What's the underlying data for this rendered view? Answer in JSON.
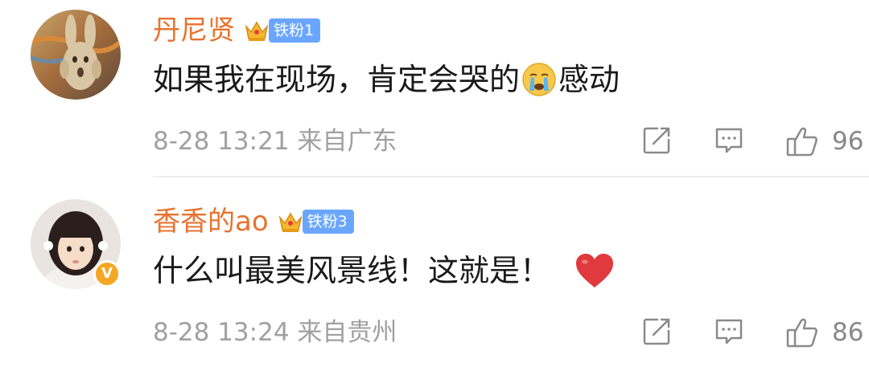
{
  "comments": [
    {
      "username": "丹尼贤",
      "fan_badge": "铁粉1",
      "text_before_emoji": "如果我在现场，肯定会哭的",
      "emoji": "crying-face-emoji",
      "text_after_emoji": "感动",
      "time": "8-28 13:21",
      "location": "来自广东",
      "likes": "96",
      "verified": false
    },
    {
      "username": "香香的ao",
      "fan_badge": "铁粉3",
      "text": "什么叫最美风景线！这就是！",
      "emoji": "red-heart-emoji",
      "time": "8-28 13:24",
      "location": "来自贵州",
      "likes": "86",
      "verified": true,
      "verified_mark": "V"
    }
  ],
  "icons": {
    "share": "share-icon",
    "comment": "comment-icon",
    "like": "thumbs-up-icon",
    "crown": "crown-icon"
  },
  "colors": {
    "username": "#e8732e",
    "fan_badge": "#6aa6ff",
    "meta_text": "#a0a0a0",
    "heart": "#e0393e",
    "verified": "#f5a623"
  }
}
